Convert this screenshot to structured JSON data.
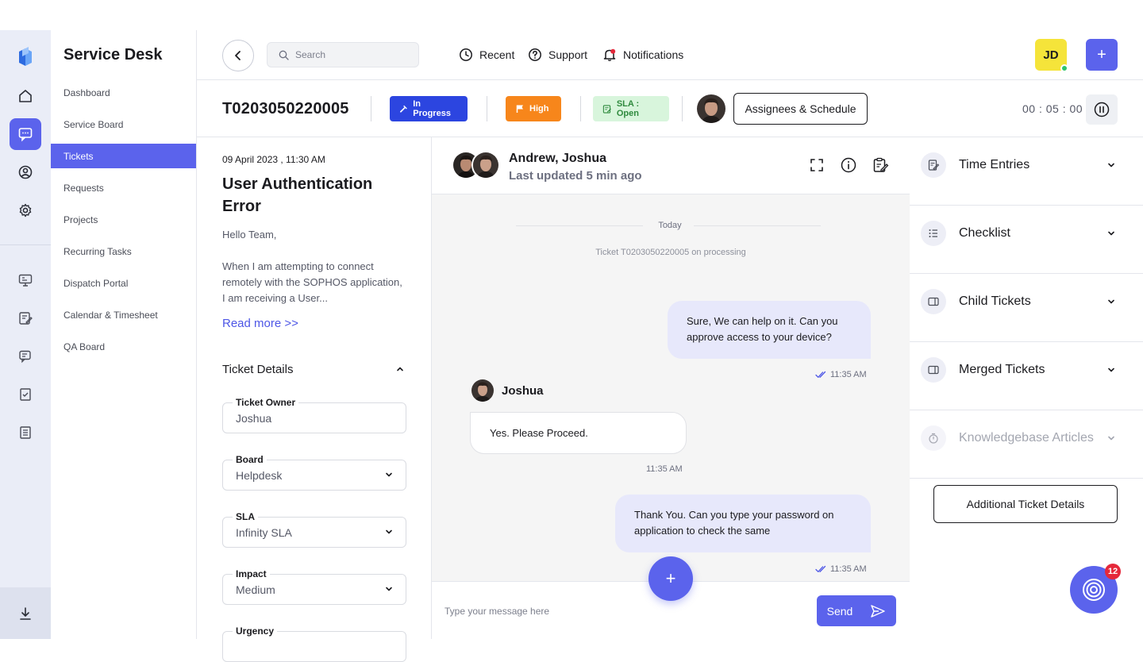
{
  "app": {
    "title": "Service Desk"
  },
  "rail": {
    "icons": [
      "logo-icon",
      "home-icon",
      "chat-icon",
      "user-circle-icon",
      "gear-icon",
      "monitor-icon",
      "edit-note-icon",
      "message-edit-icon",
      "checklist-box-icon",
      "list-doc-icon",
      "download-icon"
    ],
    "active": "chat-icon"
  },
  "nav": {
    "items": [
      {
        "label": "Dashboard"
      },
      {
        "label": "Service Board"
      },
      {
        "label": "Tickets",
        "active": true
      },
      {
        "label": "Requests"
      },
      {
        "label": "Projects"
      },
      {
        "label": "Recurring Tasks"
      },
      {
        "label": "Dispatch Portal"
      },
      {
        "label": "Calendar & Timesheet"
      },
      {
        "label": "QA Board"
      }
    ]
  },
  "header": {
    "search_placeholder": "Search",
    "links": {
      "recent": "Recent",
      "support": "Support",
      "notifications": "Notifications"
    },
    "user_initials": "JD",
    "add_label": "+"
  },
  "ticket": {
    "id": "T0203050220005",
    "status": "In Progress",
    "priority": "High",
    "sla": "SLA : Open",
    "assign_label": "Assignees & Schedule",
    "timer": "00 : 05 : 00"
  },
  "details": {
    "created": "09 April 2023 , 11:30 AM",
    "subject": "User Authentication Error",
    "greeting": "Hello Team,",
    "description": "When I am attempting to connect remotely with the SOPHOS application, I am receiving a User...",
    "read_more": "Read more >>",
    "section_title": "Ticket Details",
    "fields": {
      "owner": {
        "label": "Ticket Owner",
        "value": "Joshua"
      },
      "board": {
        "label": "Board",
        "value": "Helpdesk"
      },
      "sla": {
        "label": "SLA",
        "value": "Infinity SLA"
      },
      "impact": {
        "label": "Impact",
        "value": "Medium"
      },
      "urgency": {
        "label": "Urgency",
        "value": ""
      }
    }
  },
  "chat": {
    "participants": "Andrew, Joshua",
    "last_updated": "Last updated  5 min ago",
    "day_label": "Today",
    "system_message": "Ticket T0203050220005 on processing",
    "messages": {
      "m1": {
        "text": "Sure, We can help on it. Can you approve access to your device?",
        "time": "11:35 AM"
      },
      "m2": {
        "sender": "Joshua",
        "text": "Yes. Please Proceed.",
        "time": "11:35 AM"
      },
      "m3": {
        "text": "Thank You. Can you type your password on application to check the same",
        "time": "11:35 AM"
      }
    },
    "input_placeholder": "Type your message here",
    "send_label": "Send",
    "fab_label": "+"
  },
  "right_panel": {
    "sections": {
      "time_entries": "Time Entries",
      "checklist": "Checklist",
      "child_tickets": "Child Tickets",
      "merged_tickets": "Merged Tickets",
      "kb_articles": "Knowledgebase Articles"
    },
    "additional_label": "Additional Ticket Details",
    "help_count": "12"
  },
  "colors": {
    "accent": "#5b63ec",
    "status_in_progress": "#2c45e0",
    "priority_high": "#f7861b",
    "sla_open_bg": "#d8f5dc",
    "notification_dot": "#e5283a"
  }
}
